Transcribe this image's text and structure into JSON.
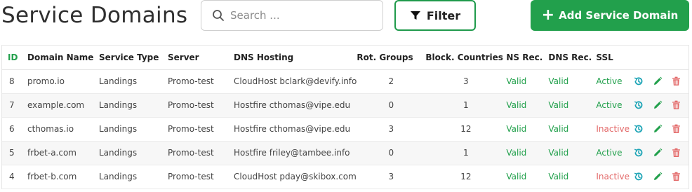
{
  "header": {
    "title": "Service Domains",
    "search_placeholder": "Search ...",
    "filter_label": "Filter",
    "add_label": "Add Service Domain"
  },
  "table": {
    "columns": [
      "ID",
      "Domain Name",
      "Service Type",
      "Server",
      "DNS Hosting",
      "Rot. Groups",
      "Block. Countries",
      "NS Rec.",
      "DNS Rec.",
      "SSL"
    ],
    "rows": [
      {
        "id": "8",
        "domain": "promo.io",
        "service_type": "Landings",
        "server": "Promo-test",
        "dns_hosting": "CloudHost bclark@devify.info",
        "rot_groups": "2",
        "block_countries": "3",
        "ns_rec": "Valid",
        "dns_rec": "Valid",
        "ssl": "Active"
      },
      {
        "id": "7",
        "domain": "example.com",
        "service_type": "Landings",
        "server": "Promo-test",
        "dns_hosting": "Hostfire cthomas@vipe.edu",
        "rot_groups": "0",
        "block_countries": "1",
        "ns_rec": "Valid",
        "dns_rec": "Valid",
        "ssl": "Active"
      },
      {
        "id": "6",
        "domain": "cthomas.io",
        "service_type": "Landings",
        "server": "Promo-test",
        "dns_hosting": "Hostfire cthomas@vipe.edu",
        "rot_groups": "3",
        "block_countries": "12",
        "ns_rec": "Valid",
        "dns_rec": "Valid",
        "ssl": "Inactive"
      },
      {
        "id": "5",
        "domain": "frbet-a.com",
        "service_type": "Landings",
        "server": "Promo-test",
        "dns_hosting": "Hostfire friley@tambee.info",
        "rot_groups": "0",
        "block_countries": "1",
        "ns_rec": "Valid",
        "dns_rec": "Valid",
        "ssl": "Active"
      },
      {
        "id": "4",
        "domain": "frbet-b.com",
        "service_type": "Landings",
        "server": "Promo-test",
        "dns_hosting": "CloudHost pday@skibox.com",
        "rot_groups": "3",
        "block_countries": "12",
        "ns_rec": "Valid",
        "dns_rec": "Valid",
        "ssl": "Inactive"
      }
    ]
  },
  "colors": {
    "accent": "#22a04c",
    "valid": "#22a04c",
    "inactive": "#e36a6a",
    "history_icon": "#1aa3b5",
    "edit_icon": "#22a04c",
    "delete_icon": "#e36a6a"
  },
  "icons": {
    "search": "search-icon",
    "filter": "funnel-icon",
    "add": "plus-icon",
    "history": "history-icon",
    "edit": "pencil-icon",
    "delete": "trash-icon"
  }
}
